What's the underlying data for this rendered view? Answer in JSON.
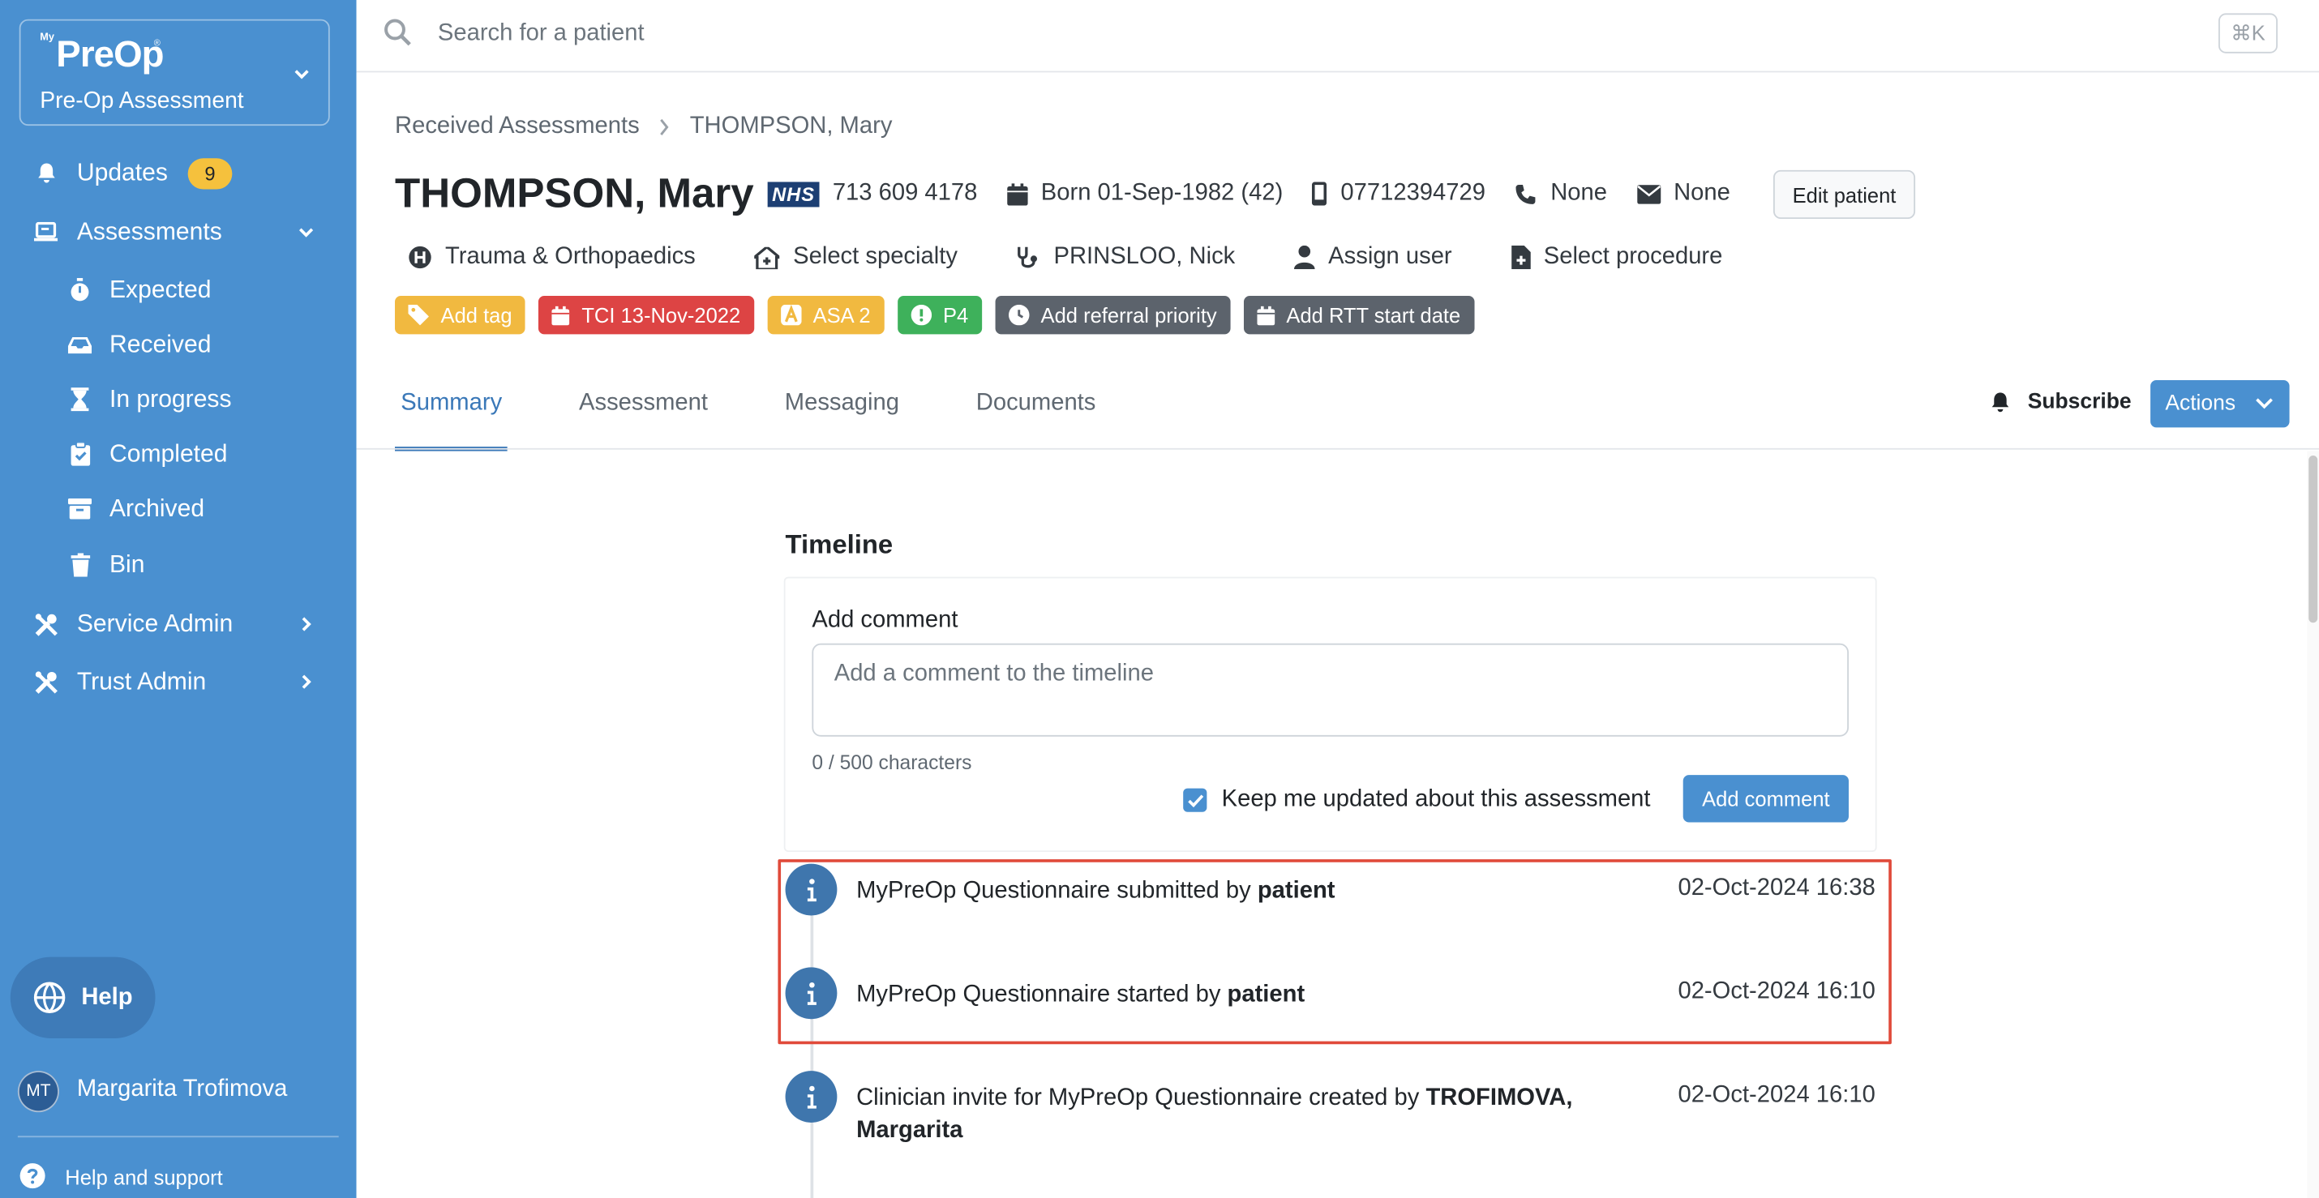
{
  "brand": {
    "logo_prefix": "My",
    "logo_text": "PreOp",
    "logo_tm": "®",
    "org_label": "Pre-Op Assessment"
  },
  "sidebar": {
    "updates": {
      "label": "Updates",
      "count": "9"
    },
    "assessments": {
      "label": "Assessments"
    },
    "sub_items": [
      {
        "label": "Expected",
        "icon": "stopwatch-icon"
      },
      {
        "label": "Received",
        "icon": "inbox-icon"
      },
      {
        "label": "In progress",
        "icon": "hourglass-icon"
      },
      {
        "label": "Completed",
        "icon": "clipboard-check-icon"
      },
      {
        "label": "Archived",
        "icon": "archive-icon"
      },
      {
        "label": "Bin",
        "icon": "trash-icon"
      }
    ],
    "service_admin": {
      "label": "Service Admin"
    },
    "trust_admin": {
      "label": "Trust Admin"
    },
    "help": {
      "label": "Help"
    },
    "user": {
      "initials": "MT",
      "name": "Margarita Trofimova"
    },
    "support": {
      "label": "Help and support"
    }
  },
  "search": {
    "placeholder": "Search for a patient",
    "shortcut": "⌘K"
  },
  "breadcrumb": {
    "parent": "Received Assessments",
    "current": "THOMPSON, Mary"
  },
  "patient": {
    "name": "THOMPSON, Mary",
    "nhs_label": "NHS",
    "nhs_number": "713 609 4178",
    "born": "Born 01-Sep-1982 (42)",
    "phone": "07712394729",
    "landline": "None",
    "email": "None",
    "edit_label": "Edit patient",
    "hospital": "Trauma & Orthopaedics",
    "specialty": "Select specialty",
    "clinician": "PRINSLOO, Nick",
    "assign_user": "Assign user",
    "procedure": "Select procedure"
  },
  "tags": [
    {
      "label": "Add tag",
      "color": "#f1b940"
    },
    {
      "label": "TCI 13-Nov-2022",
      "color": "#dd4444"
    },
    {
      "label": "ASA 2",
      "color": "#f1b940"
    },
    {
      "label": "P4",
      "color": "#3eb15b"
    },
    {
      "label": "Add referral priority",
      "color": "#5c636c"
    },
    {
      "label": "Add RTT start date",
      "color": "#5c636c"
    }
  ],
  "tabs": [
    "Summary",
    "Assessment",
    "Messaging",
    "Documents"
  ],
  "subscribe_label": "Subscribe",
  "actions_label": "Actions",
  "timeline": {
    "title": "Timeline",
    "comment_label": "Add comment",
    "comment_placeholder": "Add a comment to the timeline",
    "char_count": "0 / 500 characters",
    "keep_updated": "Keep me updated about this assessment",
    "add_comment_button": "Add comment",
    "events": [
      {
        "text": "MyPreOp Questionnaire submitted by ",
        "actor": "patient",
        "time": "02-Oct-2024 16:38"
      },
      {
        "text": "MyPreOp Questionnaire started by ",
        "actor": "patient",
        "time": "02-Oct-2024 16:10"
      },
      {
        "text": "Clinician invite for MyPreOp Questionnaire created by ",
        "actor": "TROFIMOVA, Margarita",
        "time": "02-Oct-2024 16:10"
      }
    ]
  },
  "colors": {
    "sidebar": "#4a90d0",
    "accent": "#3a78b8",
    "highlight": "#e04a3a"
  }
}
